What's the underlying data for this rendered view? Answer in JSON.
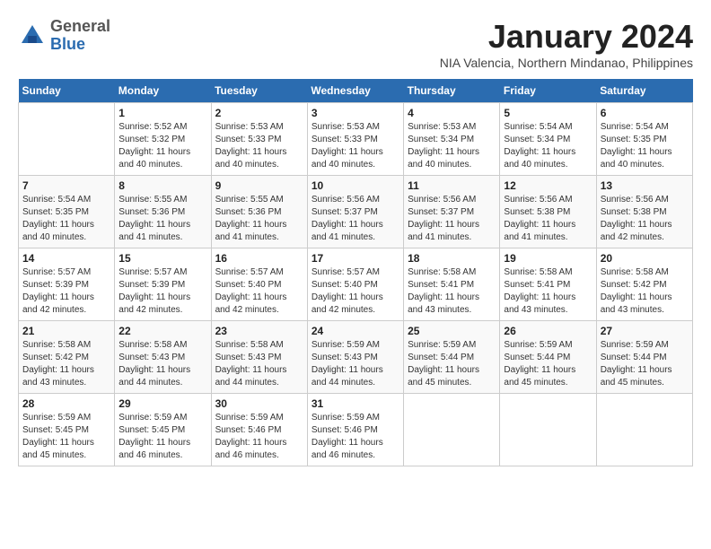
{
  "logo": {
    "general": "General",
    "blue": "Blue"
  },
  "title": "January 2024",
  "subtitle": "NIA Valencia, Northern Mindanao, Philippines",
  "days_of_week": [
    "Sunday",
    "Monday",
    "Tuesday",
    "Wednesday",
    "Thursday",
    "Friday",
    "Saturday"
  ],
  "weeks": [
    [
      {
        "day": "",
        "info": ""
      },
      {
        "day": "1",
        "info": "Sunrise: 5:52 AM\nSunset: 5:32 PM\nDaylight: 11 hours and 40 minutes."
      },
      {
        "day": "2",
        "info": "Sunrise: 5:53 AM\nSunset: 5:33 PM\nDaylight: 11 hours and 40 minutes."
      },
      {
        "day": "3",
        "info": "Sunrise: 5:53 AM\nSunset: 5:33 PM\nDaylight: 11 hours and 40 minutes."
      },
      {
        "day": "4",
        "info": "Sunrise: 5:53 AM\nSunset: 5:34 PM\nDaylight: 11 hours and 40 minutes."
      },
      {
        "day": "5",
        "info": "Sunrise: 5:54 AM\nSunset: 5:34 PM\nDaylight: 11 hours and 40 minutes."
      },
      {
        "day": "6",
        "info": "Sunrise: 5:54 AM\nSunset: 5:35 PM\nDaylight: 11 hours and 40 minutes."
      }
    ],
    [
      {
        "day": "7",
        "info": "Sunrise: 5:54 AM\nSunset: 5:35 PM\nDaylight: 11 hours and 40 minutes."
      },
      {
        "day": "8",
        "info": "Sunrise: 5:55 AM\nSunset: 5:36 PM\nDaylight: 11 hours and 41 minutes."
      },
      {
        "day": "9",
        "info": "Sunrise: 5:55 AM\nSunset: 5:36 PM\nDaylight: 11 hours and 41 minutes."
      },
      {
        "day": "10",
        "info": "Sunrise: 5:56 AM\nSunset: 5:37 PM\nDaylight: 11 hours and 41 minutes."
      },
      {
        "day": "11",
        "info": "Sunrise: 5:56 AM\nSunset: 5:37 PM\nDaylight: 11 hours and 41 minutes."
      },
      {
        "day": "12",
        "info": "Sunrise: 5:56 AM\nSunset: 5:38 PM\nDaylight: 11 hours and 41 minutes."
      },
      {
        "day": "13",
        "info": "Sunrise: 5:56 AM\nSunset: 5:38 PM\nDaylight: 11 hours and 42 minutes."
      }
    ],
    [
      {
        "day": "14",
        "info": "Sunrise: 5:57 AM\nSunset: 5:39 PM\nDaylight: 11 hours and 42 minutes."
      },
      {
        "day": "15",
        "info": "Sunrise: 5:57 AM\nSunset: 5:39 PM\nDaylight: 11 hours and 42 minutes."
      },
      {
        "day": "16",
        "info": "Sunrise: 5:57 AM\nSunset: 5:40 PM\nDaylight: 11 hours and 42 minutes."
      },
      {
        "day": "17",
        "info": "Sunrise: 5:57 AM\nSunset: 5:40 PM\nDaylight: 11 hours and 42 minutes."
      },
      {
        "day": "18",
        "info": "Sunrise: 5:58 AM\nSunset: 5:41 PM\nDaylight: 11 hours and 43 minutes."
      },
      {
        "day": "19",
        "info": "Sunrise: 5:58 AM\nSunset: 5:41 PM\nDaylight: 11 hours and 43 minutes."
      },
      {
        "day": "20",
        "info": "Sunrise: 5:58 AM\nSunset: 5:42 PM\nDaylight: 11 hours and 43 minutes."
      }
    ],
    [
      {
        "day": "21",
        "info": "Sunrise: 5:58 AM\nSunset: 5:42 PM\nDaylight: 11 hours and 43 minutes."
      },
      {
        "day": "22",
        "info": "Sunrise: 5:58 AM\nSunset: 5:43 PM\nDaylight: 11 hours and 44 minutes."
      },
      {
        "day": "23",
        "info": "Sunrise: 5:58 AM\nSunset: 5:43 PM\nDaylight: 11 hours and 44 minutes."
      },
      {
        "day": "24",
        "info": "Sunrise: 5:59 AM\nSunset: 5:43 PM\nDaylight: 11 hours and 44 minutes."
      },
      {
        "day": "25",
        "info": "Sunrise: 5:59 AM\nSunset: 5:44 PM\nDaylight: 11 hours and 45 minutes."
      },
      {
        "day": "26",
        "info": "Sunrise: 5:59 AM\nSunset: 5:44 PM\nDaylight: 11 hours and 45 minutes."
      },
      {
        "day": "27",
        "info": "Sunrise: 5:59 AM\nSunset: 5:44 PM\nDaylight: 11 hours and 45 minutes."
      }
    ],
    [
      {
        "day": "28",
        "info": "Sunrise: 5:59 AM\nSunset: 5:45 PM\nDaylight: 11 hours and 45 minutes."
      },
      {
        "day": "29",
        "info": "Sunrise: 5:59 AM\nSunset: 5:45 PM\nDaylight: 11 hours and 46 minutes."
      },
      {
        "day": "30",
        "info": "Sunrise: 5:59 AM\nSunset: 5:46 PM\nDaylight: 11 hours and 46 minutes."
      },
      {
        "day": "31",
        "info": "Sunrise: 5:59 AM\nSunset: 5:46 PM\nDaylight: 11 hours and 46 minutes."
      },
      {
        "day": "",
        "info": ""
      },
      {
        "day": "",
        "info": ""
      },
      {
        "day": "",
        "info": ""
      }
    ]
  ]
}
